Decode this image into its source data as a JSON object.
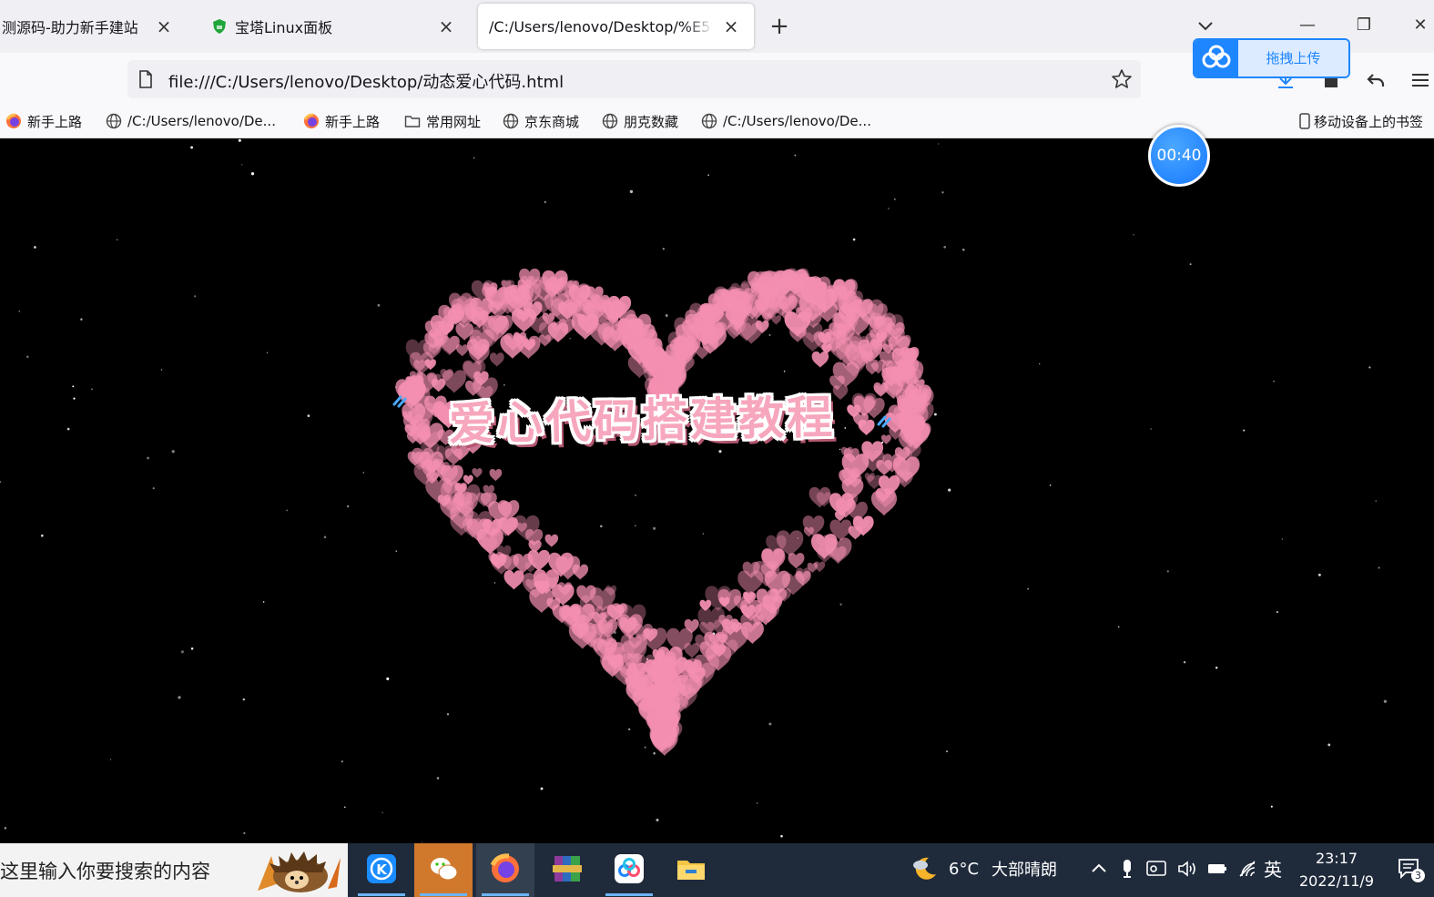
{
  "tabs": [
    {
      "label": "测源码-助力新手建站"
    },
    {
      "label": "宝塔Linux面板"
    },
    {
      "label": "/C:/Users/lenovo/Desktop/%E5%"
    }
  ],
  "tab_close_glyph": "×",
  "new_tab_glyph": "+",
  "window": {
    "minimize": "—",
    "restore": "❐",
    "close": "✕"
  },
  "address_bar": {
    "url": "file:///C:/Users/lenovo/Desktop/动态爱心代码.html"
  },
  "bookmarks": [
    {
      "label": "新手上路",
      "icon": "firefox-icon"
    },
    {
      "label": "/C:/Users/lenovo/De...",
      "icon": "globe-icon"
    },
    {
      "label": "新手上路",
      "icon": "firefox-icon"
    },
    {
      "label": "常用网址",
      "icon": "folder-icon"
    },
    {
      "label": "京东商城",
      "icon": "globe-icon"
    },
    {
      "label": "朋克数藏",
      "icon": "globe-icon"
    },
    {
      "label": "/C:/Users/lenovo/De...",
      "icon": "globe-icon"
    }
  ],
  "mobile_bookmarks": {
    "label": "移动设备上的书签"
  },
  "page": {
    "title": "爱心代码搭建教程",
    "heart_color": "#f48fb1"
  },
  "overlay": {
    "upload_label": "拖拽上传",
    "timer": "00:40"
  },
  "taskbar": {
    "search_placeholder": "这里输入你要搜索的内容",
    "apps": [
      "kugou-icon",
      "wechat-icon",
      "firefox-icon",
      "winrar-icon",
      "baidu-netdisk-icon",
      "file-explorer-icon"
    ],
    "weather": {
      "temp": "6°C",
      "desc": "大部晴朗"
    },
    "ime": "英",
    "time": "23:17",
    "date": "2022/11/9",
    "notification_count": "3"
  },
  "colors": {
    "accent": "#1e86ff",
    "taskbar": "#1f2a3b",
    "tab_strip": "#f0f0f4"
  }
}
